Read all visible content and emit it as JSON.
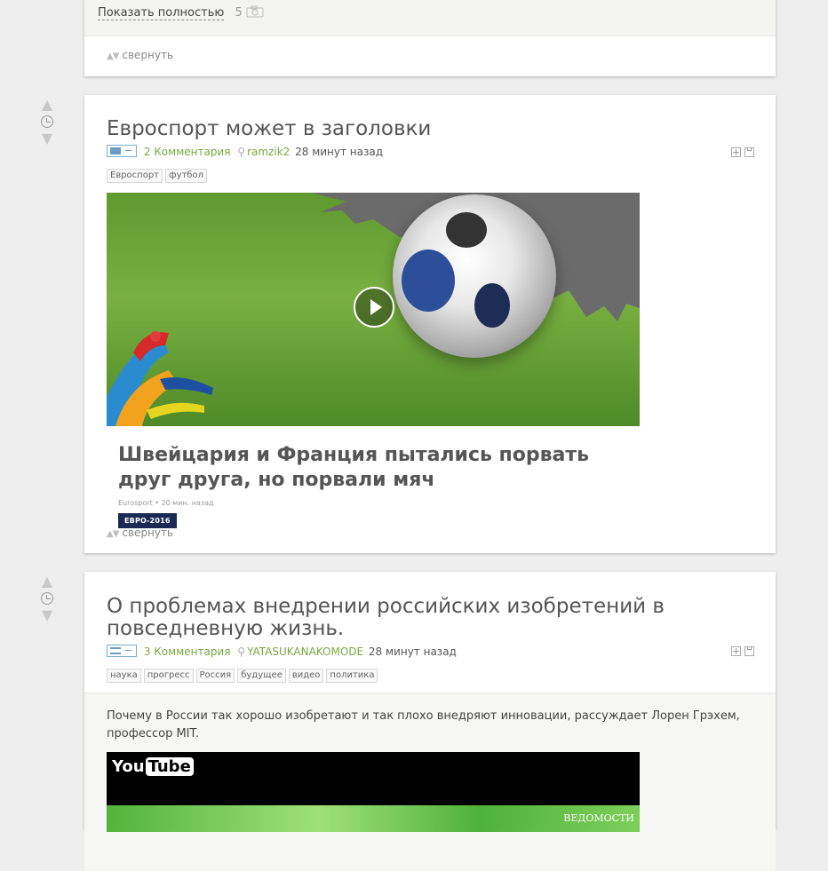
{
  "post1": {
    "show_full_label": "Показать полностью",
    "photo_count": "5",
    "collapse_label": "свернуть"
  },
  "post2": {
    "title": "Евроспорт может в заголовки",
    "comments": "2 Комментария",
    "author": "ramzik2",
    "time": "28 минут назад",
    "tags": [
      "Евроспорт",
      "футбол"
    ],
    "embed": {
      "badge": "ЕВРО-2016",
      "headline": "Швейцария и Франция пытались порвать друг друга, но порвали мяч",
      "source": "Eurosport • 20 мин. назад"
    },
    "collapse_label": "свернуть"
  },
  "post3": {
    "title": "О проблемах внедрении российских изобретений в повседневную жизнь.",
    "comments": "3 Комментария",
    "author": "YATASUKANAKOMODE",
    "time": "28 минут назад",
    "tags": [
      "наука",
      "прогресс",
      "Россия",
      "будущее",
      "видео",
      "политика"
    ],
    "description": "Почему в России так хорошо изобретают и так плохо внедряют инновации, рассуждает Лорен Грэхем, профессор MIT.",
    "video": {
      "logo_you": "You",
      "logo_tube": "Tube",
      "watermark": "ВЕДОМОСТИ"
    }
  },
  "colors": {
    "accent_green": "#77a940",
    "background": "#eeeeee",
    "badge_navy": "#1a2a55"
  },
  "icons": [
    "camera-icon",
    "vote-up-icon",
    "clock-icon",
    "vote-down-icon",
    "user-icon",
    "expand-icon",
    "save-icon",
    "play-icon"
  ]
}
